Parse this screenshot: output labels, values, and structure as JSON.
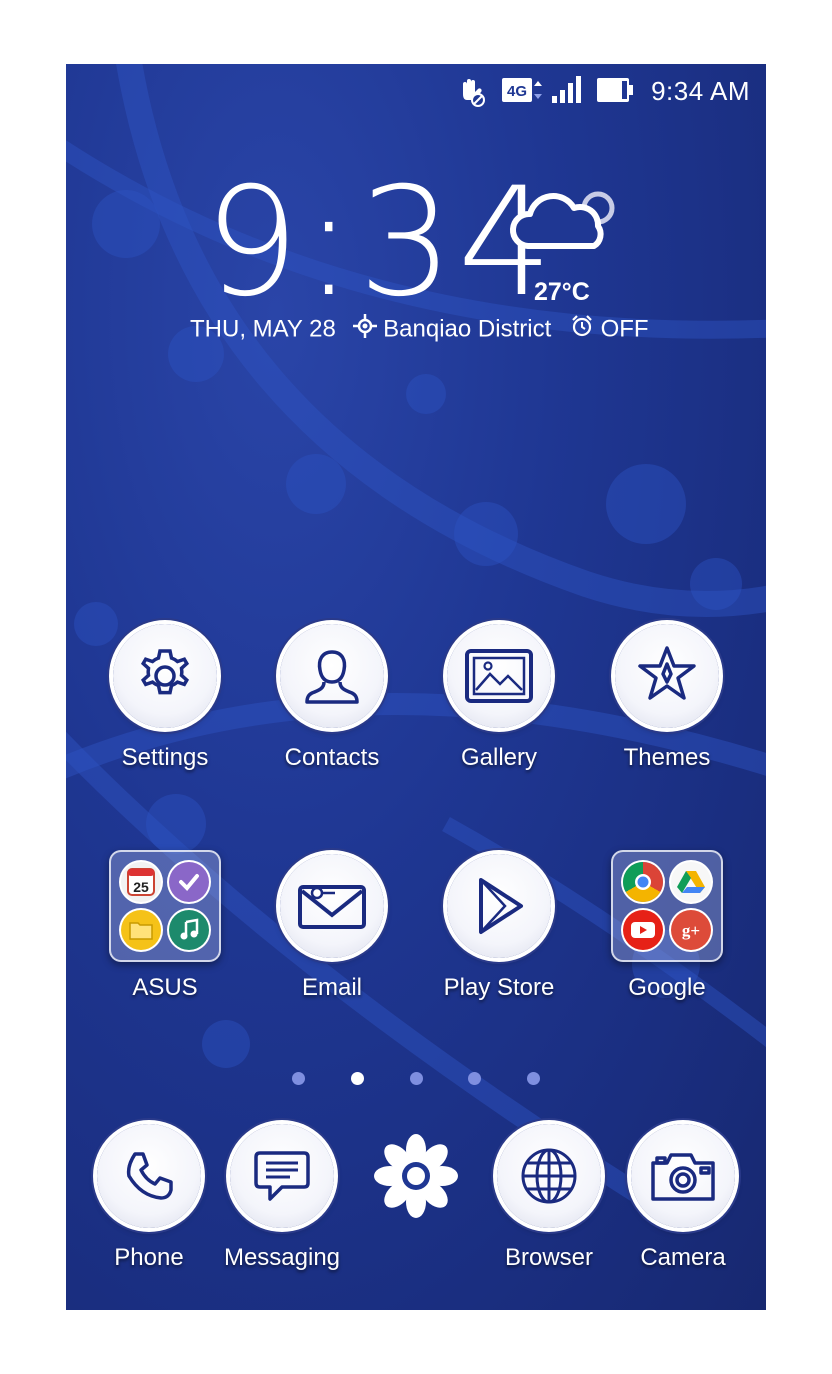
{
  "status_bar": {
    "time": "9:34 AM",
    "network_label": "4G",
    "icons": [
      "hand-blocked-icon",
      "network-4g-icon",
      "signal-icon",
      "battery-icon"
    ]
  },
  "clock_widget": {
    "time": "9:34",
    "temperature": "27°C",
    "date": "THU, MAY 28",
    "location": "Banqiao District",
    "alarm": "OFF",
    "weather_icon": "cloudy-icon"
  },
  "apps": {
    "settings": "Settings",
    "contacts": "Contacts",
    "gallery": "Gallery",
    "themes": "Themes",
    "asus": "ASUS",
    "email": "Email",
    "play_store": "Play Store",
    "google": "Google"
  },
  "asus_folder": {
    "calendar_date": "25"
  },
  "google_folder": {
    "gplus_label": "g+"
  },
  "page_indicator": {
    "count": 5,
    "active_index": 1
  },
  "dock": {
    "phone": "Phone",
    "messaging": "Messaging",
    "browser": "Browser",
    "camera": "Camera"
  },
  "colors": {
    "wallpaper": "#1f3793",
    "icon_stroke": "#1a2a80",
    "dot_inactive": "#7f8fe0",
    "dot_active": "#ffffff"
  }
}
